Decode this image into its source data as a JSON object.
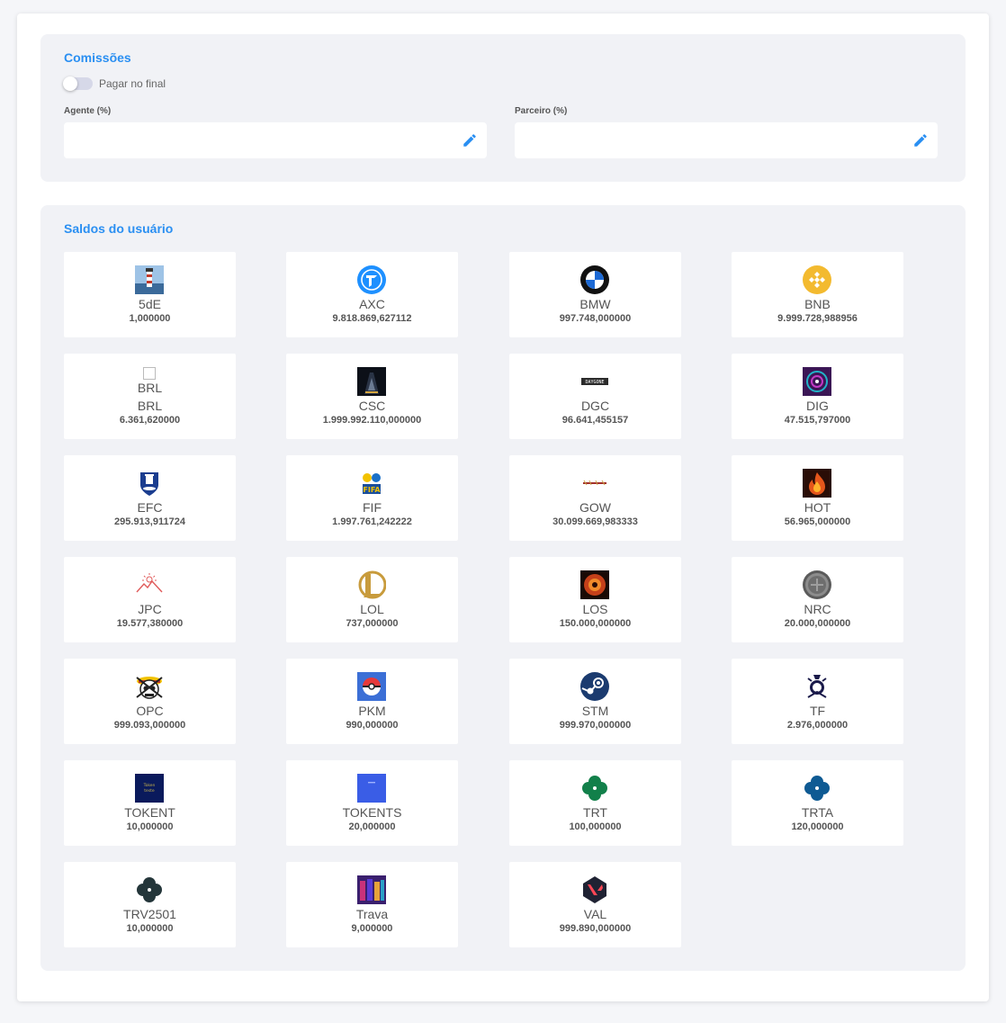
{
  "comissoes": {
    "title": "Comissões",
    "toggle_label": "Pagar no final",
    "toggle_on": false,
    "agente_label": "Agente (%)",
    "agente_value": "",
    "parceiro_label": "Parceiro (%)",
    "parceiro_value": "",
    "accent_color": "#2a8ff2"
  },
  "saldos": {
    "title": "Saldos do usuário",
    "items": [
      {
        "code": "5dE",
        "value": "1,000000",
        "icon": "lighthouse-icon"
      },
      {
        "code": "AXC",
        "value": "9.818.869,627112",
        "icon": "axc-logo-icon"
      },
      {
        "code": "BMW",
        "value": "997.748,000000",
        "icon": "bmw-logo-icon"
      },
      {
        "code": "BNB",
        "value": "9.999.728,988956",
        "icon": "bnb-logo-icon"
      },
      {
        "code": "BRL",
        "value": "6.361,620000",
        "icon": "broken-image-icon",
        "alt": "BRL"
      },
      {
        "code": "CSC",
        "value": "1.999.992.110,000000",
        "icon": "csc-logo-icon"
      },
      {
        "code": "DGC",
        "value": "96.641,455157",
        "icon": "dgc-logo-icon"
      },
      {
        "code": "DIG",
        "value": "47.515,797000",
        "icon": "dig-logo-icon"
      },
      {
        "code": "EFC",
        "value": "295.913,911724",
        "icon": "everton-crest-icon"
      },
      {
        "code": "FIF",
        "value": "1.997.761,242222",
        "icon": "fifa-logo-icon"
      },
      {
        "code": "GOW",
        "value": "30.099.669,983333",
        "icon": "gow-logo-icon"
      },
      {
        "code": "HOT",
        "value": "56.965,000000",
        "icon": "fire-icon"
      },
      {
        "code": "JPC",
        "value": "19.577,380000",
        "icon": "mountain-sun-icon"
      },
      {
        "code": "LOL",
        "value": "737,000000",
        "icon": "lol-logo-icon"
      },
      {
        "code": "LOS",
        "value": "150.000,000000",
        "icon": "los-logo-icon"
      },
      {
        "code": "NRC",
        "value": "20.000,000000",
        "icon": "coin-icon"
      },
      {
        "code": "OPC",
        "value": "999.093,000000",
        "icon": "pirate-skull-icon"
      },
      {
        "code": "PKM",
        "value": "990,000000",
        "icon": "pokeball-icon"
      },
      {
        "code": "STM",
        "value": "999.970,000000",
        "icon": "steam-logo-icon"
      },
      {
        "code": "TF",
        "value": "2.976,000000",
        "icon": "crest-icon"
      },
      {
        "code": "TOKENT",
        "value": "10,000000",
        "icon": "token-square-icon",
        "icon_text": "Token teste"
      },
      {
        "code": "TOKENTS",
        "value": "20,000000",
        "icon": "token-square-blue-icon"
      },
      {
        "code": "TRT",
        "value": "100,000000",
        "icon": "clover-green-icon"
      },
      {
        "code": "TRTA",
        "value": "120,000000",
        "icon": "clover-blue-icon"
      },
      {
        "code": "TRV2501",
        "value": "10,000000",
        "icon": "clover-dark-icon"
      },
      {
        "code": "Trava",
        "value": "9,000000",
        "icon": "trava-image-icon"
      },
      {
        "code": "VAL",
        "value": "999.890,000000",
        "icon": "valorant-logo-icon"
      }
    ]
  }
}
